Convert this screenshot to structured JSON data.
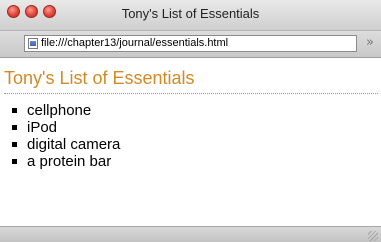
{
  "window": {
    "title": "Tony's List of Essentials",
    "colors": {
      "close": "#e0443a",
      "heading": "#d28a24"
    }
  },
  "addressbar": {
    "url": "file:///chapter13/journal/essentials.html",
    "overflow_symbol": "»"
  },
  "page": {
    "heading": "Tony's List of Essentials",
    "items": [
      "cellphone",
      "iPod",
      "digital camera",
      "a protein bar"
    ]
  },
  "icons": [
    "close-icon",
    "minimize-icon",
    "zoom-icon",
    "file-icon",
    "overflow-chevron-icon",
    "resize-grip-icon"
  ]
}
